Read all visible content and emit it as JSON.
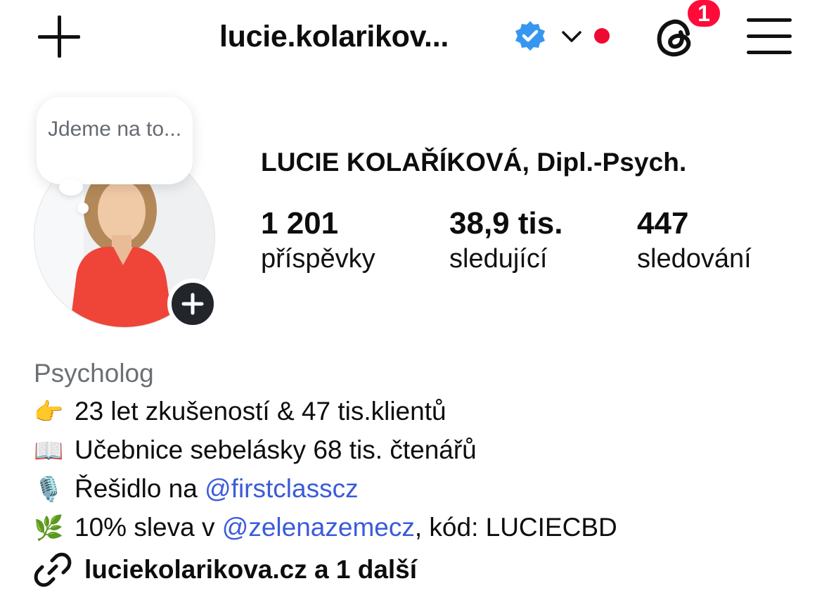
{
  "header": {
    "username": "lucie.kolarikov...",
    "notification_count": "1"
  },
  "profile": {
    "note": "Jdeme na to...",
    "full_name": "LUCIE KOLAŘÍKOVÁ, Dipl.-Psych.",
    "stats": [
      {
        "value": "1 201",
        "label": "příspěvky"
      },
      {
        "value": "38,9 tis.",
        "label": "sledující"
      },
      {
        "value": "447",
        "label": "sledování"
      }
    ]
  },
  "bio": {
    "category": "Psycholog",
    "line1": {
      "emoji": "👉",
      "text": "23 let zkušeností & 47 tis.klientů"
    },
    "line2": {
      "emoji": "📖",
      "text": "Učebnice sebelásky 68 tis. čtenářů"
    },
    "line3": {
      "emoji": "🎙️",
      "text": "Řešidlo na ",
      "mention": "@firstclasscz"
    },
    "line4": {
      "emoji": "🌿",
      "text": "10% sleva v ",
      "mention": "@zelenazemecz",
      "suffix": ", kód: LUCIECBD"
    },
    "link": "luciekolarikova.cz a 1 další"
  },
  "colors": {
    "verified": "#3797f0",
    "notification_red": "#ff0b3a",
    "mention": "#3b5bdb",
    "category": "#6b6f75"
  },
  "icons": [
    "plus-icon",
    "verified-icon",
    "chevron-down-icon",
    "threads-icon",
    "menu-icon",
    "link-icon"
  ]
}
